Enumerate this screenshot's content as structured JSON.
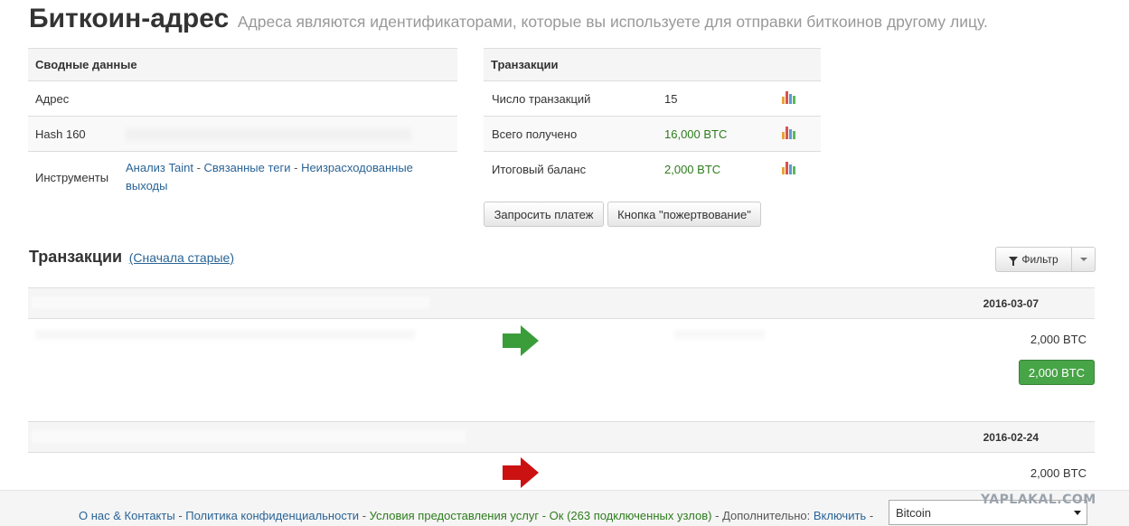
{
  "header": {
    "title": "Биткоин-адрес",
    "subtitle": "Адреса являются идентификаторами, которые вы используете для отправки биткоинов другому лицу."
  },
  "summary": {
    "heading": "Сводные данные",
    "address_label": "Адрес",
    "hash160_label": "Hash 160",
    "tools_label": "Инструменты",
    "tools_links": [
      "Анализ Taint",
      "Связанные теги",
      "Неизрасходованные выходы"
    ],
    "separator": " - "
  },
  "transactions_summary": {
    "heading": "Транзакции",
    "rows": [
      {
        "label": "Число транзакций",
        "value": "15"
      },
      {
        "label": "Всего получено",
        "value": "16,000 BTC"
      },
      {
        "label": "Итоговый баланс",
        "value": "2,000 BTC"
      }
    ]
  },
  "buttons": {
    "request_payment": "Запросить платеж",
    "donate": "Кнопка \"пожертвование\""
  },
  "transactions": {
    "title": "Транзакции",
    "sort_link": "(Сначала старые)",
    "filter_label": "Фильтр",
    "items": [
      {
        "date": "2016-03-07",
        "amount": "2,000 BTC",
        "total": "2,000 BTC",
        "direction": "in"
      },
      {
        "date": "2016-02-24",
        "amount": "2,000 BTC",
        "direction": "out"
      }
    ]
  },
  "footer": {
    "about": "О нас & Контакты",
    "privacy": "Политика конфиденциальности",
    "terms": "Условия предоставления услуг",
    "status": "Ок (263 подключенных узлов)",
    "extra_label": "Дополнительно:",
    "enable": "Включить",
    "currency": "Bitcoin"
  },
  "watermark": "YAPLAKAL.COM",
  "colors": {
    "link": "#2a6496",
    "green_text": "#2d7c1d",
    "success_button": "#47a447",
    "arrow_in": "#3a9d3a",
    "arrow_out": "#cc1111"
  }
}
